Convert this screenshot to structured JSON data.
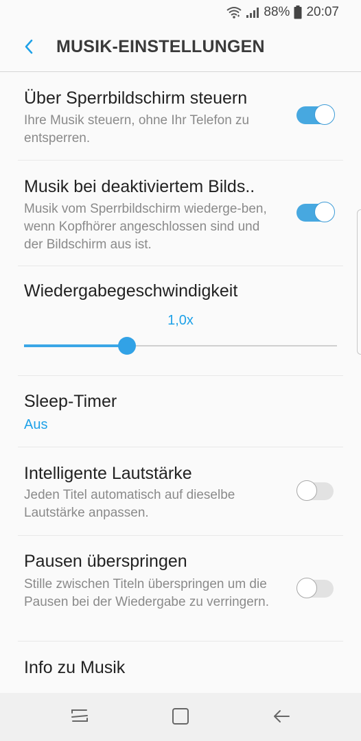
{
  "status": {
    "battery_percent": "88%",
    "time": "20:07",
    "icons": [
      "wifi-icon",
      "signal-icon",
      "battery-icon"
    ]
  },
  "header": {
    "title": "MUSIK-EINSTELLUNGEN",
    "back_icon": "back-chevron-icon"
  },
  "settings": {
    "lockscreen": {
      "title": "Über Sperrbildschirm steuern",
      "desc": "Ihre Musik steuern, ohne Ihr Telefon zu entsperren.",
      "enabled": true
    },
    "screen_off": {
      "title": "Musik bei deaktiviertem Bilds..",
      "desc": "Musik vom Sperrbildschirm wiederge-ben, wenn Kopfhörer angeschlossen sind und der Bildschirm aus ist.",
      "enabled": true
    },
    "playback_speed": {
      "title": "Wiedergabegeschwindigkeit",
      "value": "1,0x",
      "slider_fraction": 0.33
    },
    "sleep_timer": {
      "title": "Sleep-Timer",
      "value": "Aus"
    },
    "smart_volume": {
      "title": "Intelligente Lautstärke",
      "desc": "Jeden Titel automatisch auf dieselbe Lautstärke anpassen.",
      "enabled": false
    },
    "skip_silence": {
      "title": "Pausen überspringen",
      "desc": "Stille zwischen Titeln überspringen um die Pausen bei der Wiedergabe zu verringern.",
      "enabled": false
    },
    "about": {
      "title": "Info zu Musik"
    }
  },
  "navbar": {
    "icons": [
      "recent-apps-icon",
      "home-icon",
      "back-arrow-icon"
    ]
  },
  "colors": {
    "accent": "#1ea1e8",
    "toggle_on": "#47a8e0",
    "toggle_off": "#e2e2e2"
  }
}
